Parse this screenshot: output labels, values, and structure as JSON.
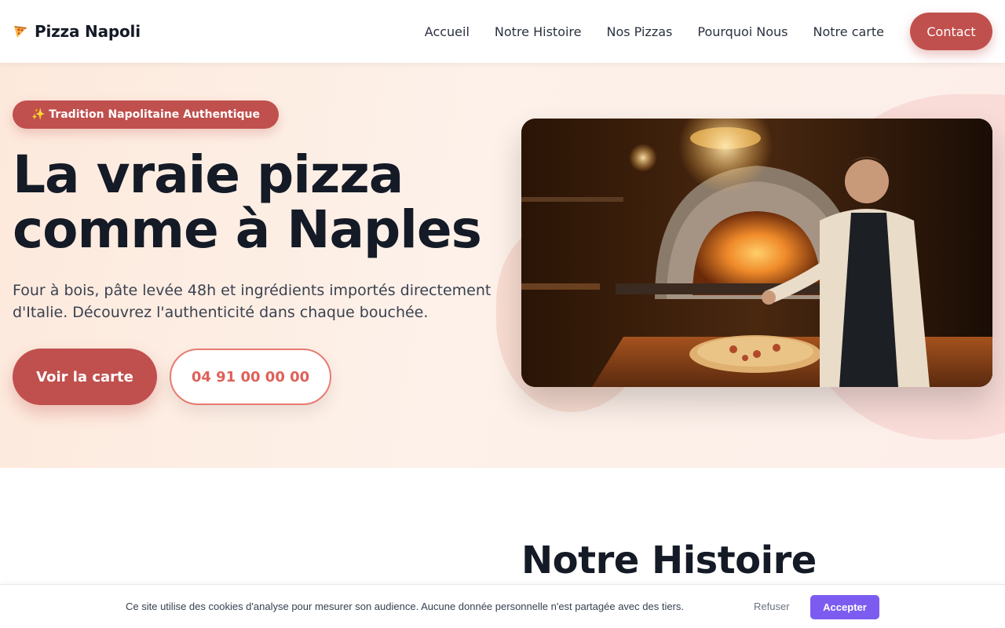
{
  "header": {
    "logo_icon": "pizza-slice-icon",
    "logo_text": "Pizza Napoli",
    "nav": [
      {
        "label": "Accueil"
      },
      {
        "label": "Notre Histoire"
      },
      {
        "label": "Nos Pizzas"
      },
      {
        "label": "Pourquoi Nous"
      },
      {
        "label": "Notre carte"
      }
    ],
    "contact_label": "Contact"
  },
  "hero": {
    "badge": "✨ Tradition Napolitaine Authentique",
    "title": "La vraie pizza comme à Naples",
    "subtitle": "Four à bois, pâte levée 48h et ingrédients importés directement d'Italie. Découvrez l'authenticité dans chaque bouchée.",
    "primary_cta": "Voir la carte",
    "secondary_cta": "04 91 00 00 00",
    "image_subject": "pizzaiolo-wood-fired-oven-photo"
  },
  "histoire": {
    "title": "Notre Histoire"
  },
  "cookie_banner": {
    "text": "Ce site utilise des cookies d'analyse pour mesurer son audience. Aucune donnée personnelle n'est partagée avec des tiers.",
    "refuse_label": "Refuser",
    "accept_label": "Accepter"
  },
  "colors": {
    "brand": "#c0504d",
    "accent_phone": "#e0605a",
    "cookie_accept": "#7c5cf0",
    "heading": "#141a26"
  }
}
